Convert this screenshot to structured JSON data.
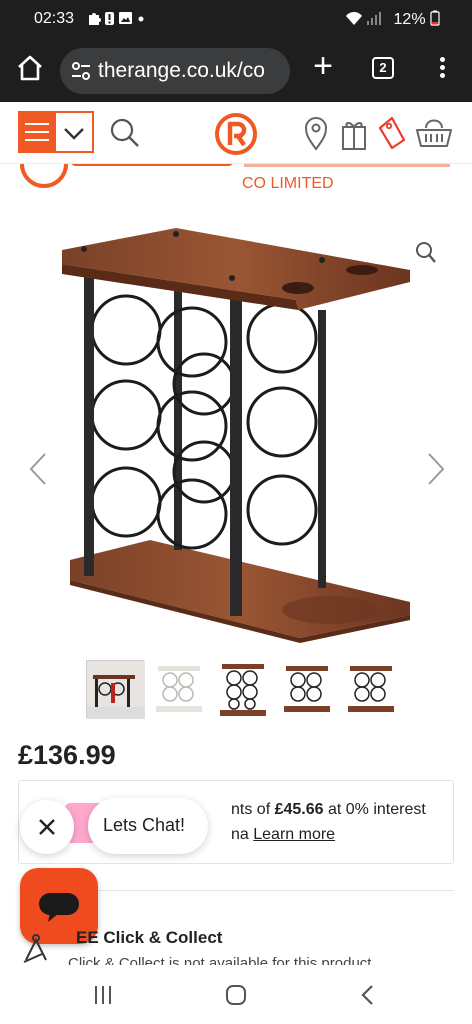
{
  "status_bar": {
    "time": "02:33",
    "battery": "12%",
    "notification_icons": [
      "puzzle-icon",
      "alert-icon",
      "image-icon",
      "dot-icon"
    ],
    "system_icons": [
      "wifi-icon",
      "signal-icon",
      "battery-icon"
    ]
  },
  "browser": {
    "url": "therange.co.uk/co",
    "tab_count": "2",
    "new_tab_label": "+"
  },
  "site_header": {
    "brand_color": "#ef5a24",
    "icons": [
      "menu-icon",
      "chevron-down-icon",
      "search-icon",
      "logo-icon",
      "location-pin-icon",
      "gift-icon",
      "tag-icon",
      "basket-icon"
    ]
  },
  "banner": {
    "text": "CO LIMITED"
  },
  "product": {
    "price": "£136.99",
    "thumbnail_count": 5
  },
  "payment": {
    "line1_prefix": "nts of ",
    "line1_amount": "£45.66",
    "line1_suffix": " at 0% interest",
    "line2_prefix": "na ",
    "learn_more": "Learn more"
  },
  "chat": {
    "bubble_text": "Lets Chat!",
    "close_label": "×"
  },
  "click_collect": {
    "title": "EE Click & Collect",
    "subtitle": "Click & Collect is not available for this product"
  },
  "nav": {
    "icons": [
      "recent-apps-icon",
      "home-icon",
      "back-icon"
    ]
  }
}
